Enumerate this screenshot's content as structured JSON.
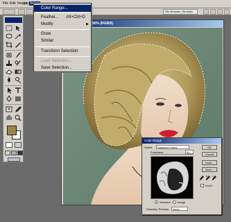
{
  "menubar": {
    "items": [
      "File",
      "Edit",
      "Image",
      "Layer",
      "Select"
    ]
  },
  "options_bar": {
    "palette_label": "File Browser | Brushes"
  },
  "document": {
    "title": "50% (RGB/8)"
  },
  "select_menu": {
    "items": [
      {
        "label": "Color Range...",
        "shortcut": "",
        "submenu": false,
        "highlighted": true,
        "disabled": false
      },
      {
        "label": "Feather...",
        "shortcut": "Alt+Ctrl+D",
        "submenu": false,
        "highlighted": false,
        "disabled": false
      },
      {
        "label": "Modify",
        "shortcut": "",
        "submenu": true,
        "highlighted": false,
        "disabled": false
      },
      {
        "label": "Grow",
        "shortcut": "",
        "submenu": false,
        "highlighted": false,
        "disabled": false
      },
      {
        "label": "Similar",
        "shortcut": "",
        "submenu": false,
        "highlighted": false,
        "disabled": false
      },
      {
        "label": "Transform Selection",
        "shortcut": "",
        "submenu": false,
        "highlighted": false,
        "disabled": false
      },
      {
        "label": "Load Selection...",
        "shortcut": "",
        "submenu": false,
        "highlighted": false,
        "disabled": true
      },
      {
        "label": "Save Selection...",
        "shortcut": "",
        "submenu": false,
        "highlighted": false,
        "disabled": false
      }
    ]
  },
  "color_range": {
    "title": "Color Range",
    "select_label": "Select:",
    "select_value": "Sampled Colors",
    "fuzziness_label": "Fuzziness:",
    "fuzziness_value": "40",
    "radio_selection": "Selection",
    "radio_image": "Image",
    "preview_label": "Selection Preview:",
    "preview_value": "None",
    "buttons": [
      "OK",
      "Cancel",
      "Load...",
      "Save..."
    ],
    "invert_label": "Invert",
    "colors": {
      "title_start": "#0a246a",
      "title_end": "#a6caf0"
    }
  },
  "toolbox": {
    "foreground_color": "#9a8448",
    "background_color": "#ffffff"
  }
}
